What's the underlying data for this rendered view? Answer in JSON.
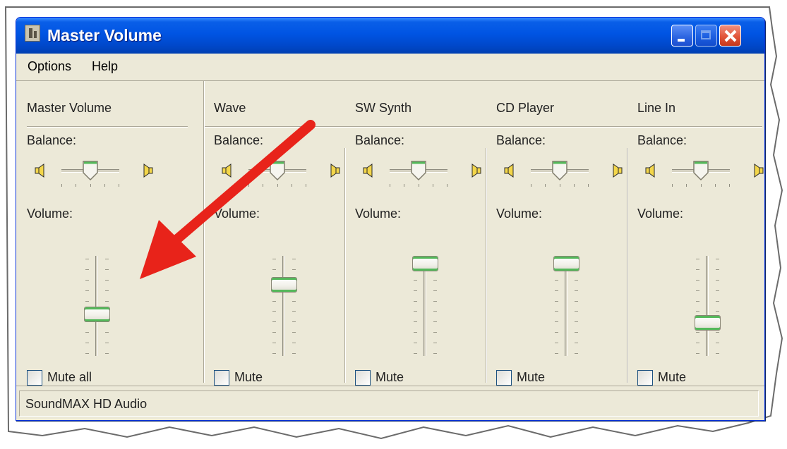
{
  "window": {
    "title": "Master Volume"
  },
  "menu": {
    "options": "Options",
    "help": "Help"
  },
  "channels": [
    {
      "name": "Master Volume",
      "balance_label": "Balance:",
      "volume_label": "Volume:",
      "mute_label": "Mute all",
      "volume_level": 0.4,
      "balance": 0.5,
      "muted": false
    },
    {
      "name": "Wave",
      "balance_label": "Balance:",
      "volume_label": "Volume:",
      "mute_label": "Mute",
      "volume_level": 0.75,
      "balance": 0.5,
      "muted": false
    },
    {
      "name": "SW Synth",
      "balance_label": "Balance:",
      "volume_label": "Volume:",
      "mute_label": "Mute",
      "volume_level": 1.0,
      "balance": 0.5,
      "muted": false
    },
    {
      "name": "CD Player",
      "balance_label": "Balance:",
      "volume_label": "Volume:",
      "mute_label": "Mute",
      "volume_level": 1.0,
      "balance": 0.5,
      "muted": false
    },
    {
      "name": "Line In",
      "balance_label": "Balance:",
      "volume_label": "Volume:",
      "mute_label": "Mute",
      "volume_level": 0.3,
      "balance": 0.5,
      "muted": false
    }
  ],
  "status": {
    "text": "SoundMAX HD Audio"
  },
  "colors": {
    "titlebar": "#0054e3",
    "window_bg": "#ece9d8",
    "thumb_accent": "#54b85a",
    "annotation_arrow": "#e8231a"
  }
}
